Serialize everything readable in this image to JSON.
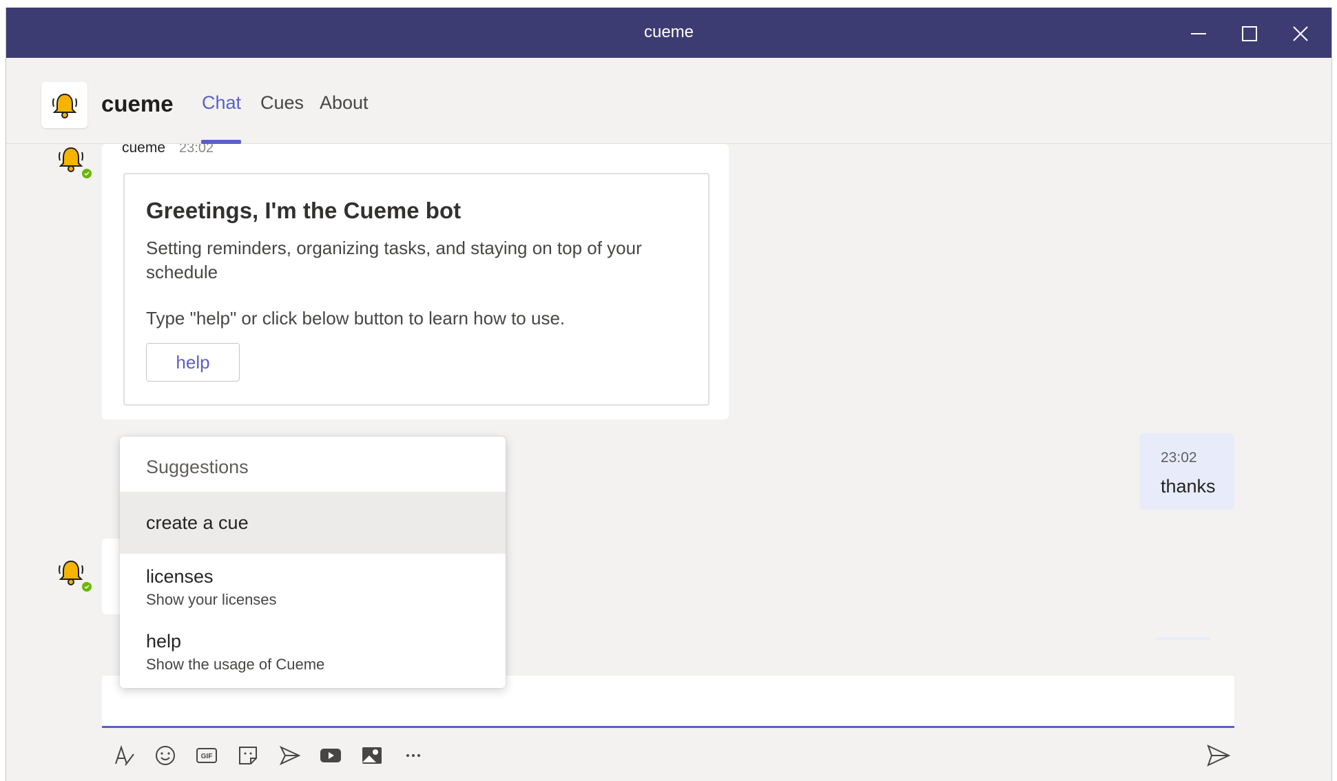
{
  "window": {
    "title": "cueme",
    "controls": [
      "minimize-icon",
      "maximize-icon",
      "close-icon"
    ]
  },
  "app": {
    "name": "cueme",
    "logo_icon": "bell-icon",
    "tabs": [
      {
        "label": "Chat",
        "active": true
      },
      {
        "label": "Cues",
        "active": false
      },
      {
        "label": "About",
        "active": false
      }
    ]
  },
  "messages": {
    "bot_message": {
      "sender": "cueme",
      "time": "23:02",
      "card": {
        "title": "Greetings, I'm the Cueme bot",
        "text": "Setting reminders, organizing tasks, and staying on top of your schedule",
        "text2": "Type \"help\" or click below button to learn how to use.",
        "button_label": "help"
      }
    },
    "user_message": {
      "time": "23:02",
      "text": "thanks"
    }
  },
  "suggestions": {
    "header": "Suggestions",
    "items": [
      {
        "title": "create a cue",
        "subtitle": ""
      },
      {
        "title": "licenses",
        "subtitle": "Show your licenses"
      },
      {
        "title": "help",
        "subtitle": "Show the usage of Cueme"
      }
    ]
  },
  "compose": {
    "value": "",
    "toolbar_icons": [
      "format-icon",
      "emoji-icon",
      "gif-icon",
      "sticker-icon",
      "praise-icon",
      "video-icon",
      "image-icon",
      "more-options-icon"
    ],
    "send_icon": "send-icon"
  },
  "colors": {
    "titlebar": "#3d3c72",
    "accent": "#5b5fc7",
    "user_bubble": "#e8ebfa",
    "presence": "#6bb700",
    "bell": "#f5b400"
  }
}
